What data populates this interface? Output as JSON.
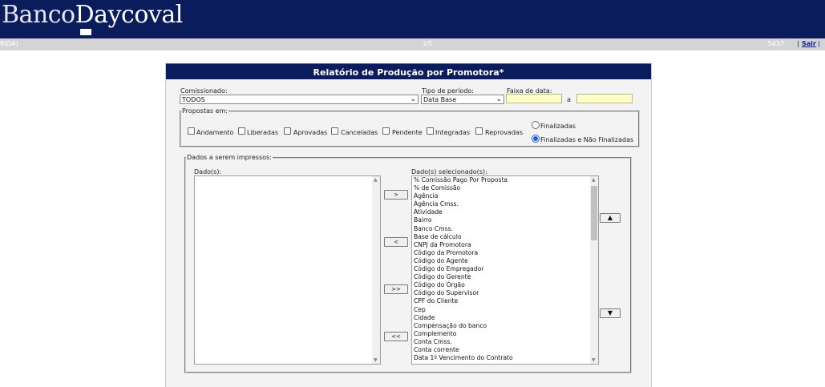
{
  "header": {
    "brand_part1": "Banco",
    "brand_part2": "Daycoval"
  },
  "infobar": {
    "left_text": "RIDA]",
    "mid_text": "US",
    "right_text": ".5437",
    "logout_label": "Sair"
  },
  "form": {
    "title": "Relatório de Produção por Promotora*",
    "comissionado": {
      "label": "Comissionado:",
      "value": "TODOS"
    },
    "tipo_periodo": {
      "label": "Tipo de período:",
      "value": "Data Base"
    },
    "faixa_data": {
      "label": "Faixa de data:",
      "separator": "a"
    },
    "propostas": {
      "legend": "Propostas em:",
      "checkboxes": [
        "Andamento",
        "Liberadas",
        "Aprovadas",
        "Canceladas",
        "Pendente",
        "Integradas",
        "Reprovadas"
      ],
      "radios": [
        {
          "label": "Finalizadas",
          "selected": false
        },
        {
          "label": "Finalizadas e Não Finalizadas",
          "selected": true
        }
      ]
    },
    "dados": {
      "legend": "Dados a serem impressos:",
      "available_label": "Dado(s):",
      "selected_label": "Dado(s) selecionado(s):",
      "selected_items": [
        "% Comissão Pago Por Proposta",
        "% de Comissão",
        "Agência",
        "Agência Cmss.",
        "Atividade",
        "Bairro",
        "Banco Cmss.",
        "Base de cálculo",
        "CNPJ da Promotora",
        "Código da Promotora",
        "Código do Agente",
        "Código do Empregador",
        "Código do Gerente",
        "Código do Órgão",
        "Código do Supervisor",
        "CPF do Cliente",
        "Cep",
        "Cidade",
        "Compensação do banco",
        "Complemento",
        "Conta Cmss.",
        "Conta corrente",
        "Data 1º Vencimento do Contrato"
      ],
      "buttons": {
        "add_one": ">",
        "remove_one": "<",
        "add_all": ">>",
        "remove_all": "<<",
        "move_up": "▲",
        "move_down": "▼"
      }
    }
  },
  "colors": {
    "topbar": "#0a1c5c",
    "date_input_bg": "#ffffc8",
    "radio_accent": "#1a5dd6"
  }
}
